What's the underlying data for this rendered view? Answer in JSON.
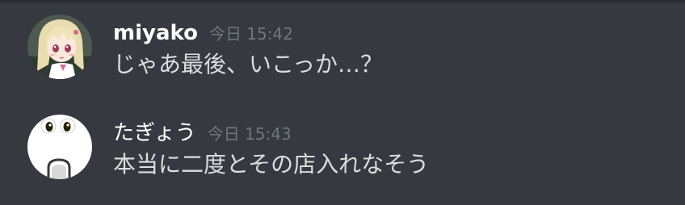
{
  "messages": [
    {
      "author": "miyako",
      "timestamp": "今日 15:42",
      "content": "じゃあ最後、いこっか…？",
      "avatar_icon": "anime-girl-avatar-icon"
    },
    {
      "author": "たぎょう",
      "timestamp": "今日 15:43",
      "content": "本当に二度とその店入れなそう",
      "avatar_icon": "shocked-face-avatar-icon"
    }
  ],
  "colors": {
    "background": "#36393f",
    "username": "#ffffff",
    "timestamp": "#72767d",
    "message_text": "#dcddde"
  }
}
